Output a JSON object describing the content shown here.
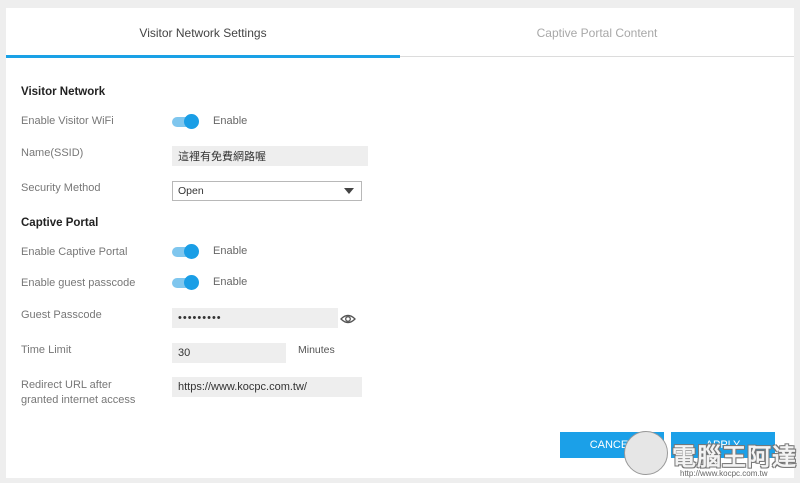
{
  "tabs": {
    "active": "Visitor Network Settings",
    "inactive": "Captive Portal Content"
  },
  "visitor_network": {
    "title": "Visitor Network",
    "enable_wifi_label": "Enable Visitor WiFi",
    "enable_wifi_state": "Enable",
    "ssid_label": "Name(SSID)",
    "ssid_value": "這裡有免費網路喔",
    "security_label": "Security Method",
    "security_value": "Open"
  },
  "captive_portal": {
    "title": "Captive Portal",
    "enable_portal_label": "Enable Captive Portal",
    "enable_portal_state": "Enable",
    "enable_passcode_label": "Enable guest passcode",
    "enable_passcode_state": "Enable",
    "passcode_label": "Guest Passcode",
    "passcode_value": "•••••••••",
    "time_limit_label": "Time Limit",
    "time_limit_value": "30",
    "time_limit_units": "Minutes",
    "redirect_label_line1": "Redirect URL after",
    "redirect_label_line2": "granted internet access",
    "redirect_value": "https://www.kocpc.com.tw/"
  },
  "buttons": {
    "cancel": "CANCEL",
    "apply": "APPLY"
  },
  "watermark": {
    "text": "電腦王阿達",
    "url": "http://www.kocpc.com.tw"
  },
  "colors": {
    "accent": "#1aa1e6",
    "toggle_knob": "#1a9ee6",
    "toggle_track": "#7fc6ee"
  }
}
